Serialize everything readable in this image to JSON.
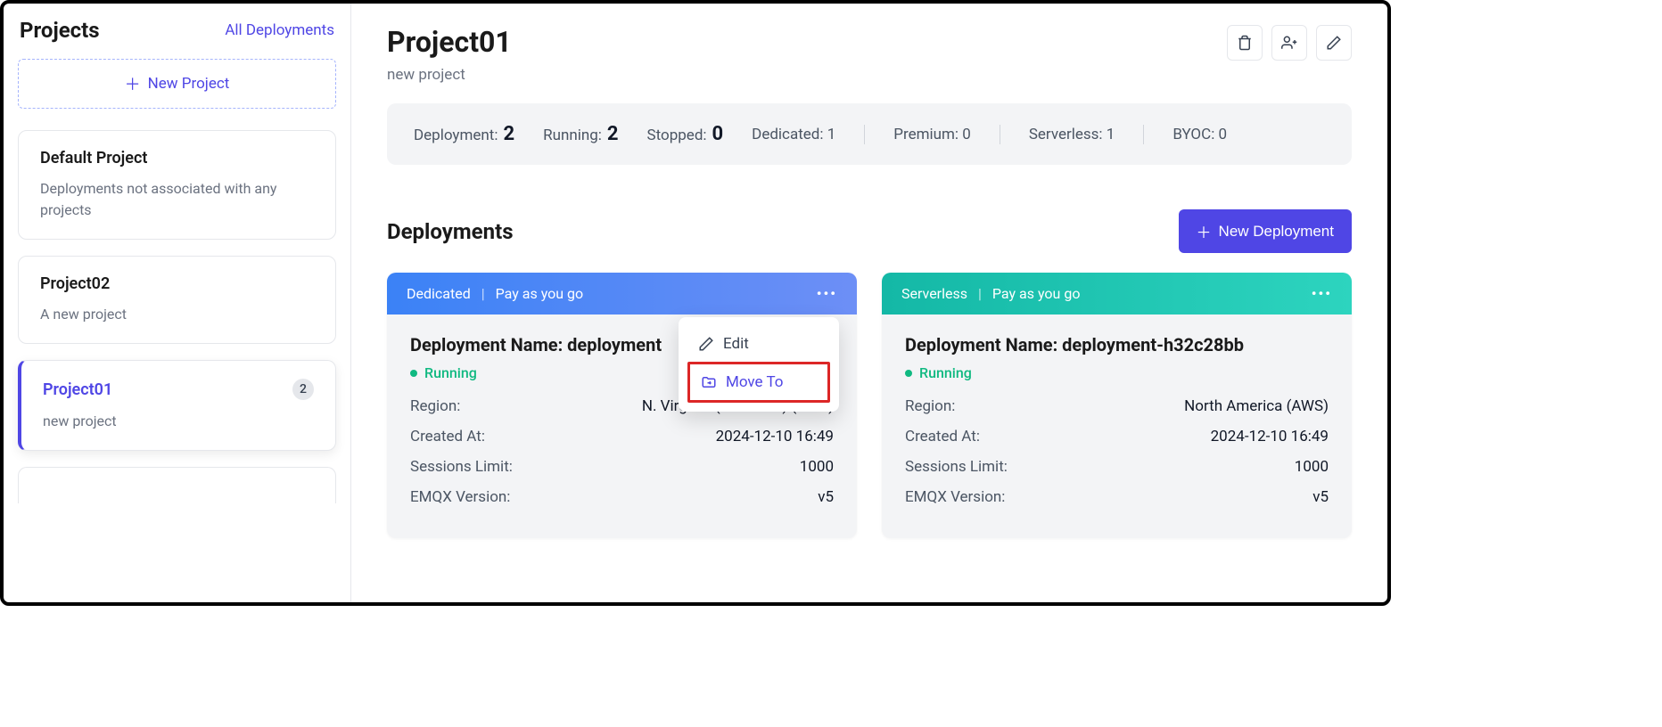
{
  "sidebar": {
    "title": "Projects",
    "all_deployments": "All Deployments",
    "new_project": "New Project",
    "projects": [
      {
        "name": "Default Project",
        "desc": "Deployments not associated with any projects"
      },
      {
        "name": "Project02",
        "desc": "A new project"
      },
      {
        "name": "Project01",
        "desc": "new project",
        "count": "2"
      }
    ]
  },
  "header": {
    "title": "Project01",
    "subtitle": "new project"
  },
  "stats": {
    "deployment_label": "Deployment:",
    "deployment_val": "2",
    "running_label": "Running:",
    "running_val": "2",
    "stopped_label": "Stopped:",
    "stopped_val": "0",
    "dedicated_label": "Dedicated: 1",
    "premium_label": "Premium: 0",
    "serverless_label": "Serverless: 1",
    "byoc_label": "BYOC: 0"
  },
  "deployments": {
    "title": "Deployments",
    "new_btn": "New Deployment",
    "cards": [
      {
        "tier": "Dedicated",
        "plan": "Pay as you go",
        "name": "Deployment Name: deployment",
        "status": "Running",
        "region_label": "Region:",
        "region": "N. Virginia (us-east-1) (AWS)",
        "created_label": "Created At:",
        "created": "2024-12-10 16:49",
        "sessions_label": "Sessions Limit:",
        "sessions": "1000",
        "version_label": "EMQX Version:",
        "version": "v5"
      },
      {
        "tier": "Serverless",
        "plan": "Pay as you go",
        "name": "Deployment Name: deployment-h32c28bb",
        "status": "Running",
        "region_label": "Region:",
        "region": "North America (AWS)",
        "created_label": "Created At:",
        "created": "2024-12-10 16:49",
        "sessions_label": "Sessions Limit:",
        "sessions": "1000",
        "version_label": "EMQX Version:",
        "version": "v5"
      }
    ]
  },
  "dropdown": {
    "edit": "Edit",
    "move_to": "Move To"
  }
}
